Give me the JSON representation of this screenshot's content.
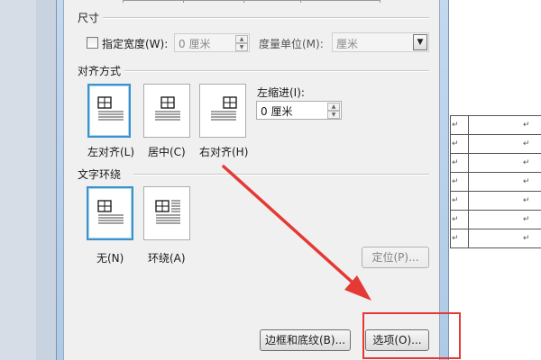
{
  "size_section": {
    "title": "尺寸",
    "specify_width_label": "指定宽度(W):",
    "width_value": "0 厘米",
    "unit_label": "度量单位(M):",
    "unit_value": "厘米"
  },
  "alignment_section": {
    "title": "对齐方式",
    "options": [
      {
        "label": "左对齐(L)",
        "selected": true
      },
      {
        "label": "居中(C)",
        "selected": false
      },
      {
        "label": "右对齐(H)",
        "selected": false
      }
    ],
    "left_indent_label": "左缩进(I):",
    "left_indent_value": "0 厘米"
  },
  "wrap_section": {
    "title": "文字环绕",
    "options": [
      {
        "label": "无(N)",
        "selected": true
      },
      {
        "label": "环绕(A)",
        "selected": false
      }
    ]
  },
  "buttons": {
    "position": "定位(P)...",
    "borders_shading": "边框和底纹(B)...",
    "options": "选项(O)..."
  },
  "doc_table": {
    "rows": [
      [
        "↵",
        "↵"
      ],
      [
        "↵",
        "↵"
      ],
      [
        "↵",
        "↵"
      ],
      [
        "↵",
        "↵"
      ],
      [
        "↵",
        "↵"
      ],
      [
        "↵",
        "↵"
      ],
      [
        "↵",
        "↵"
      ]
    ]
  },
  "colors": {
    "selection_border": "#3c92ca",
    "annotation_red": "#e53935"
  }
}
